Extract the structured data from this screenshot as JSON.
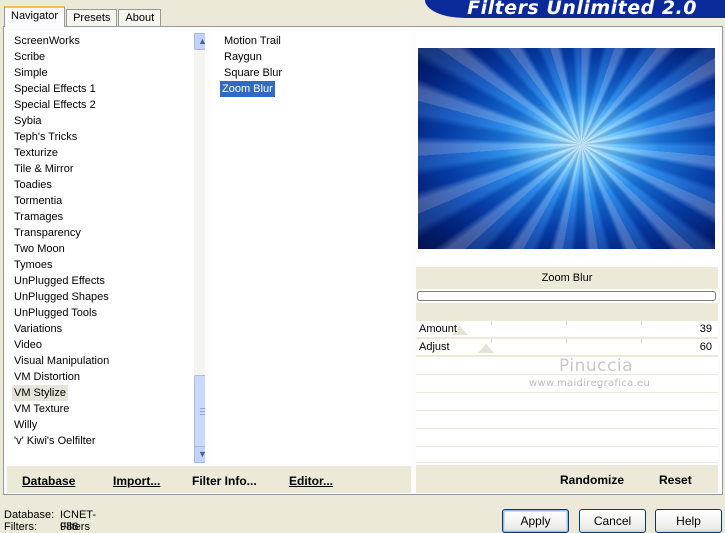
{
  "tabs": [
    "Navigator",
    "Presets",
    "About"
  ],
  "banner_title": "Filters Unlimited 2.0",
  "categories": [
    "ScreenWorks",
    "Scribe",
    "Simple",
    "Special Effects 1",
    "Special Effects 2",
    "Sybia",
    "Teph's Tricks",
    "Texturize",
    "Tile & Mirror",
    "Toadies",
    "Tormentia",
    "Tramages",
    "Transparency",
    "Two Moon",
    "Tymoes",
    "UnPlugged Effects",
    "UnPlugged Shapes",
    "UnPlugged Tools",
    "Variations",
    "Video",
    "Visual Manipulation",
    "VM Distortion",
    "VM Stylize",
    "VM Texture",
    "Willy",
    "'v' Kiwi's Oelfilter"
  ],
  "selected_category": "VM Stylize",
  "filters": [
    "Motion Trail",
    "Raygun",
    "Square Blur",
    "Zoom Blur"
  ],
  "selected_filter": "Zoom Blur",
  "preview_filter_name": "Zoom Blur",
  "sliders": [
    {
      "label": "Amount",
      "value": "39"
    },
    {
      "label": "Adjust",
      "value": "60"
    }
  ],
  "watermark": {
    "name": "Pinuccia",
    "url": "www.maidiregrafica.eu"
  },
  "left_buttons": [
    "Database",
    "Import...",
    "Filter Info...",
    "Editor..."
  ],
  "right_buttons": [
    "Randomize",
    "Reset"
  ],
  "status": {
    "database_label": "Database:",
    "database_value": "ICNET-Filters",
    "filters_label": "Filters:",
    "filters_value": "986"
  },
  "dialog_buttons": [
    "Apply",
    "Cancel",
    "Help"
  ],
  "colors": {
    "selection": "#316ac5",
    "banner": "#0a2a9a",
    "dialog_bg": "#ece9d8"
  }
}
